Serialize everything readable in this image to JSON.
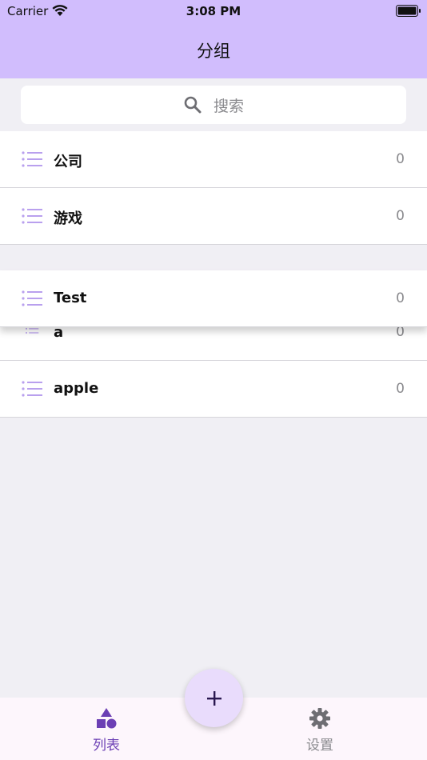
{
  "status_bar": {
    "carrier": "Carrier",
    "time": "3:08 PM"
  },
  "header": {
    "title": "分组"
  },
  "search": {
    "placeholder": "搜索"
  },
  "groups": [
    {
      "label": "公司",
      "count": "0"
    },
    {
      "label": "游戏",
      "count": "0"
    },
    {
      "label": "Test",
      "count": "0"
    },
    {
      "label": "a",
      "count": "0"
    },
    {
      "label": "apple",
      "count": "0"
    }
  ],
  "tabs": {
    "list_label": "列表",
    "settings_label": "设置"
  },
  "colors": {
    "accent": "#d1bdfd",
    "active_tab": "#6b3fb4",
    "fab": "#e9dcfc",
    "list_icon": "#b9a0ee"
  },
  "icons": {
    "search": "search-icon",
    "row": "list-icon",
    "tab_list": "shapes-icon",
    "tab_settings": "gear-icon",
    "fab": "plus-icon"
  }
}
